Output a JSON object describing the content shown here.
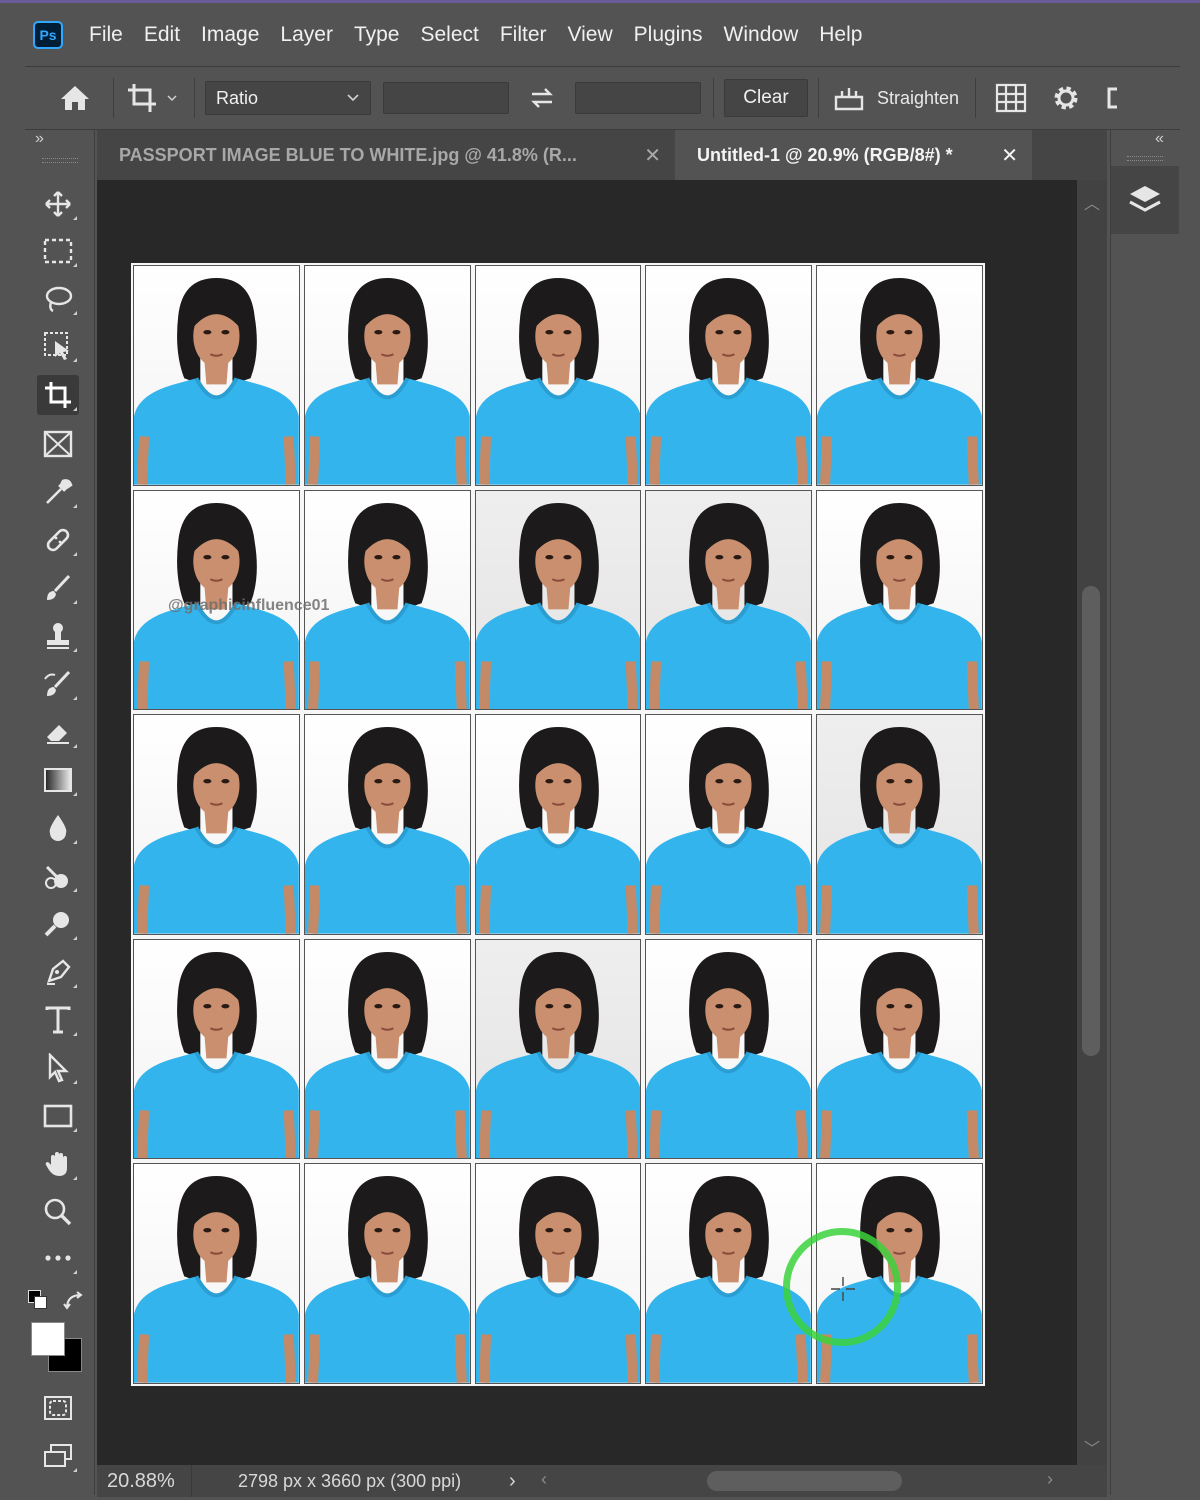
{
  "app": {
    "logo": "Ps"
  },
  "menu": [
    "File",
    "Edit",
    "Image",
    "Layer",
    "Type",
    "Select",
    "Filter",
    "View",
    "Plugins",
    "Window",
    "Help"
  ],
  "options": {
    "ratio_label": "Ratio",
    "ratio_width_value": "",
    "ratio_height_value": "",
    "clear_label": "Clear",
    "straighten_label": "Straighten"
  },
  "tabs": [
    {
      "label": "PASSPORT IMAGE BLUE TO WHITE.jpg @ 41.8% (R...",
      "active": false
    },
    {
      "label": "Untitled-1 @ 20.9% (RGB/8#) *",
      "active": true
    }
  ],
  "canvas": {
    "grid_rows": 5,
    "grid_cols": 5,
    "watermark": "@graphicinfluence01",
    "shirt_color": "#34b4ec",
    "hair_color": "#1c1a1a",
    "skin_color": "#c98f6e"
  },
  "status": {
    "zoom": "20.88%",
    "doc_info": "2798 px x 3660 px (300 ppi)"
  },
  "colors": {
    "foreground": "#ffffff",
    "background": "#000000",
    "accent": "#31a8ff"
  }
}
